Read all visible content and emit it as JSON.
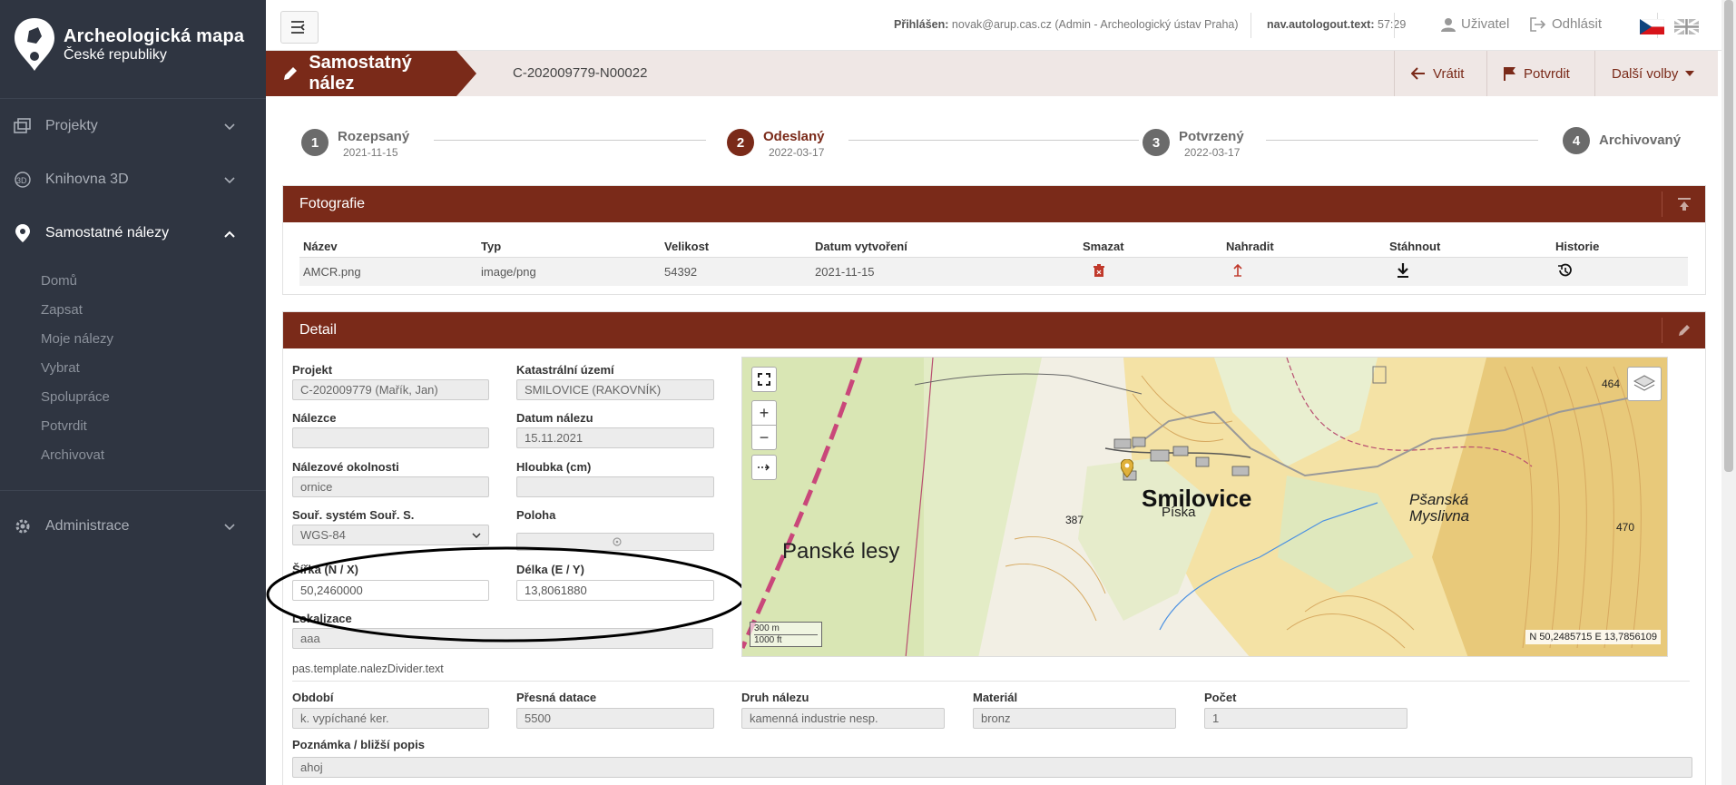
{
  "app": {
    "logo_line1": "Archeologická mapa",
    "logo_line2": "České republiky"
  },
  "sidebar": {
    "items": [
      {
        "label": "Projekty",
        "icon": "projects-icon"
      },
      {
        "label": "Knihovna 3D",
        "icon": "3d-icon"
      },
      {
        "label": "Samostatné nálezy",
        "icon": "map-pin-icon"
      },
      {
        "label": "Administrace",
        "icon": "gear-icon"
      }
    ],
    "subitems": [
      "Domů",
      "Zapsat",
      "Moje nálezy",
      "Vybrat",
      "Spolupráce",
      "Potvrdit",
      "Archivovat"
    ]
  },
  "topbar": {
    "logged_label": "Přihlášen:",
    "logged_value": "novak@arup.cas.cz (Admin - Archeologický ústav Praha)",
    "autologout_label": "nav.autologout.text:",
    "autologout_value": "57:29",
    "user_label": "Uživatel",
    "logout_label": "Odhlásit"
  },
  "header": {
    "title": "Samostatný nález",
    "ident": "C-202009779-N00022",
    "btn_return": "Vrátit",
    "btn_confirm": "Potvrdit",
    "btn_more": "Další volby"
  },
  "steps": [
    {
      "num": "1",
      "label": "Rozepsaný",
      "date": "2021-11-15"
    },
    {
      "num": "2",
      "label": "Odeslaný",
      "date": "2022-03-17"
    },
    {
      "num": "3",
      "label": "Potvrzený",
      "date": "2022-03-17"
    },
    {
      "num": "4",
      "label": "Archivovaný",
      "date": ""
    }
  ],
  "photos": {
    "title": "Fotografie",
    "columns": [
      "Název",
      "Typ",
      "Velikost",
      "Datum vytvoření",
      "Smazat",
      "Nahradit",
      "Stáhnout",
      "Historie"
    ],
    "rows": [
      {
        "name": "AMCR.png",
        "type": "image/png",
        "size": "54392",
        "date": "2021-11-15"
      }
    ]
  },
  "detail": {
    "title": "Detail",
    "projekt_label": "Projekt",
    "projekt_value": "C-202009779 (Mařík, Jan)",
    "katastr_label": "Katastrální území",
    "katastr_value": "SMILOVICE (RAKOVNÍK)",
    "nalezce_label": "Nálezce",
    "nalezce_value": "",
    "datum_label": "Datum nálezu",
    "datum_value": "15.11.2021",
    "okolnosti_label": "Nálezové okolnosti",
    "okolnosti_value": "ornice",
    "hloubka_label": "Hloubka (cm)",
    "hloubka_value": "",
    "system_label": "Souř. systém Souř. S.",
    "system_value": "WGS-84",
    "poloha_label": "Poloha",
    "sirka_label": "Šířka (N / X)",
    "sirka_value": "50,2460000",
    "delka_label": "Délka (E / Y)",
    "delka_value": "13,8061880",
    "lokalizace_label": "Lokalizace",
    "lokalizace_value": "aaa",
    "divider_text": "pas.template.nalezDivider.text",
    "obdobi_label": "Období",
    "obdobi_value": "k. vypíchané ker.",
    "presna_label": "Přesná datace",
    "presna_value": "5500",
    "druh_label": "Druh nálezu",
    "druh_value": "kamenná industrie nesp.",
    "material_label": "Materiál",
    "material_value": "bronz",
    "pocet_label": "Počet",
    "pocet_value": "1",
    "poznamka_label": "Poznámka / bližší popis",
    "poznamka_value": "ahoj"
  },
  "map": {
    "town": "Smilovice",
    "sub": "Píska",
    "forest": "Panské lesy",
    "place2": "Pšanská Myslivna",
    "coord": "N 50,2485715 E 13,7856109",
    "scale_m": "300 m",
    "scale_ft": "1000 ft",
    "elev1": "387",
    "elev2": "470",
    "elev3": "464"
  }
}
